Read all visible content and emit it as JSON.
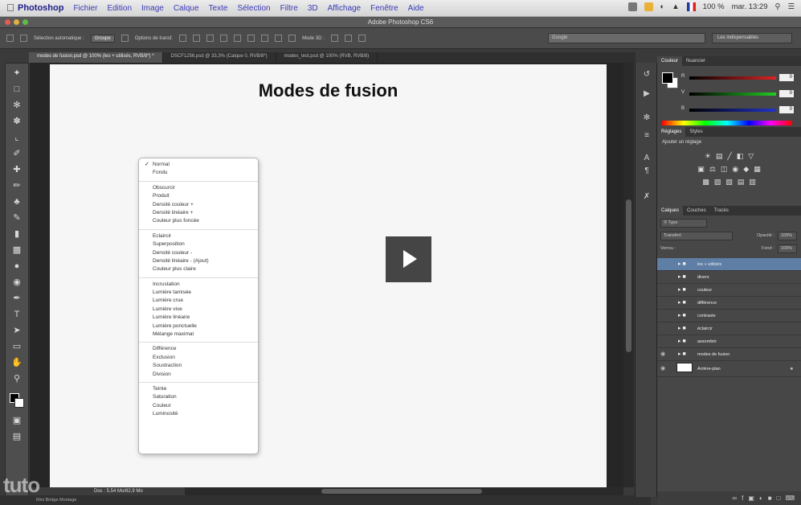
{
  "menubar": {
    "app": "Photoshop",
    "items": [
      "Fichier",
      "Edition",
      "Image",
      "Calque",
      "Texte",
      "Sélection",
      "Filtre",
      "3D",
      "Affichage",
      "Fenêtre",
      "Aide"
    ],
    "battery": "100 %",
    "clock": "mar. 13:29"
  },
  "window": {
    "title": "Adobe Photoshop CS6"
  },
  "options": {
    "auto_select": "Sélection automatique :",
    "group": "Groupe",
    "transform": "Options de transf.",
    "mode_3d": "Mode 3D :",
    "search_placeholder": "Google",
    "workspace": "Les indispensables"
  },
  "doc_tabs": [
    "modes de fusion.psd @ 100% (les + utilisés, RVB/8*) *",
    "DSCF1256.psd @ 33,3% (Calque 0, RVB/8*)",
    "modes_test.psd @ 100% (RVB, RVB/8)"
  ],
  "canvas": {
    "title": "Modes de fusion",
    "blend_groups": [
      [
        "Normal",
        "Fondu"
      ],
      [
        "Obscurcir",
        "Produit",
        "Densité couleur +",
        "Densité linéaire +",
        "Couleur plus foncée"
      ],
      [
        "Eclaircir",
        "Superposition",
        "Densité couleur -",
        "Densité linéaire - (Ajout)",
        "Couleur plus claire"
      ],
      [
        "Incrustation",
        "Lumière tamisée",
        "Lumière crue",
        "Lumière vive",
        "Lumière linéaire",
        "Lumière ponctuelle",
        "Mélange maximal"
      ],
      [
        "Différence",
        "Exclusion",
        "Soustraction",
        "Division"
      ],
      [
        "Teinte",
        "Saturation",
        "Couleur",
        "Luminosité"
      ]
    ],
    "checked_item": "Normal"
  },
  "status": {
    "doc": "Doc : 5,54 Mo/82,9 Mo"
  },
  "bottom": {
    "tabs": "Mini Bridge   Montage"
  },
  "watermark": "tuto",
  "panels": {
    "color": {
      "tabs": [
        "Couleur",
        "Nuancier"
      ],
      "channels": [
        {
          "label": "R",
          "value": "0",
          "color": "#d22"
        },
        {
          "label": "V",
          "value": "0",
          "color": "#2c2"
        },
        {
          "label": "B",
          "value": "0",
          "color": "#23c"
        }
      ]
    },
    "adjust": {
      "tabs": [
        "Réglages",
        "Styles"
      ],
      "heading": "Ajouter un réglage"
    },
    "layers": {
      "tabs": [
        "Calques",
        "Couches",
        "Tracés"
      ],
      "kind": "Type",
      "blend": "Transfert",
      "opacity_label": "Opacité :",
      "opacity": "100%",
      "lock_label": "Verrou :",
      "fill_label": "Fond :",
      "fill": "100%",
      "items": [
        {
          "name": "les + utilisés",
          "selected": true,
          "visible": false
        },
        {
          "name": "divers",
          "selected": false,
          "visible": false
        },
        {
          "name": "couleur",
          "selected": false,
          "visible": false
        },
        {
          "name": "différence",
          "selected": false,
          "visible": false
        },
        {
          "name": "contraste",
          "selected": false,
          "visible": false
        },
        {
          "name": "éclaircir",
          "selected": false,
          "visible": false
        },
        {
          "name": "assombrir",
          "selected": false,
          "visible": false
        },
        {
          "name": "modes de fusion",
          "selected": false,
          "visible": true
        }
      ],
      "background": "Arrière-plan"
    }
  }
}
